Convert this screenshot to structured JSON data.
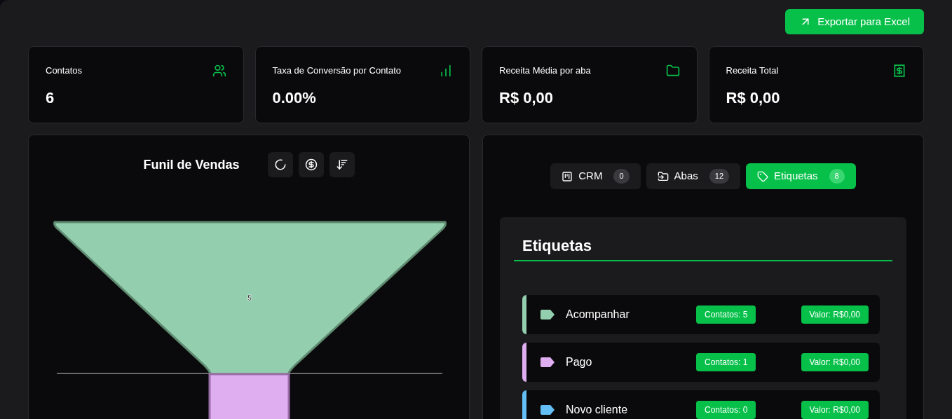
{
  "export_button": {
    "label": "Exportar para Excel"
  },
  "stats": [
    {
      "kind": "users",
      "label": "Contatos",
      "value": "6"
    },
    {
      "kind": "chart",
      "label": "Taxa de Conversão por Contato",
      "value": "0.00%"
    },
    {
      "kind": "folder",
      "label": "Receita Média por aba",
      "value": "R$ 0,00"
    },
    {
      "kind": "receipt",
      "label": "Receita Total",
      "value": "R$ 0,00"
    }
  ],
  "funnel": {
    "title": "Funil de Vendas",
    "tools": [
      {
        "kind": "donut"
      },
      {
        "kind": "money"
      },
      {
        "kind": "sort"
      }
    ],
    "stages": [
      {
        "value_label": "5",
        "color": "#93cfae"
      },
      {
        "color": "#dfaef0"
      }
    ]
  },
  "tabs": [
    {
      "kind": "crm",
      "label": "CRM",
      "count": "0",
      "selected": false
    },
    {
      "kind": "abas",
      "label": "Abas",
      "count": "12",
      "selected": false
    },
    {
      "kind": "tags",
      "label": "Etiquetas",
      "count": "8",
      "selected": true
    }
  ],
  "tags_panel": {
    "title": "Etiquetas",
    "items": [
      {
        "name": "Acompanhar",
        "color": "#93cfae",
        "contacts": "Contatos: 5",
        "value": "Valor: R$0,00"
      },
      {
        "name": "Pago",
        "color": "#dfaef0",
        "contacts": "Contatos: 1",
        "value": "Valor: R$0,00"
      },
      {
        "name": "Novo cliente",
        "color": "#63bff5",
        "contacts": "Contatos: 0",
        "value": "Valor: R$0,00"
      }
    ]
  }
}
